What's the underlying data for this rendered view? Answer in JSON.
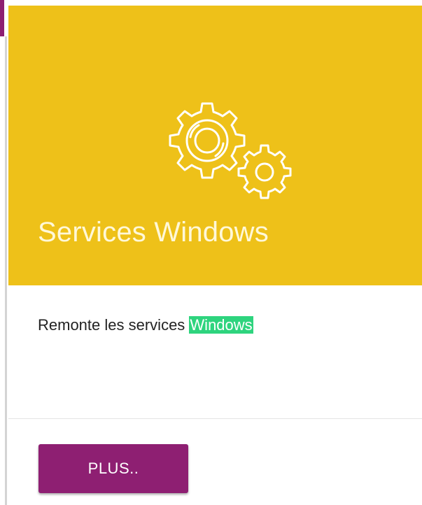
{
  "card": {
    "title": "Services Windows",
    "description_prefix": "Remonte les services ",
    "description_highlight": "Windows",
    "button_label": "PLUS..",
    "icon": "gears-icon"
  },
  "colors": {
    "header_bg": "#eec119",
    "title_text": "#fff8d8",
    "button_bg": "#8e1f72",
    "highlight_bg": "#2ed47e"
  }
}
